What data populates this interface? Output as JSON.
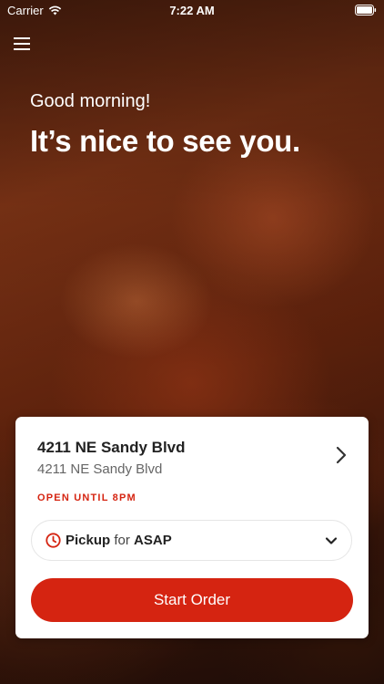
{
  "status_bar": {
    "carrier": "Carrier",
    "time": "7:22 AM",
    "wifi_icon": "wifi-icon",
    "battery_icon": "battery-icon"
  },
  "header": {
    "menu_icon": "hamburger-menu-icon",
    "greeting": "Good morning!",
    "headline": "It’s nice to see you."
  },
  "location_card": {
    "name": "4211 NE Sandy Blvd",
    "address": "4211 NE Sandy Blvd",
    "hours_status": "OPEN UNTIL 8PM",
    "chevron_icon": "chevron-right-icon"
  },
  "order_options": {
    "clock_icon": "clock-icon",
    "mode": "Pickup",
    "connector": "for",
    "time": "ASAP",
    "dropdown_icon": "chevron-down-icon"
  },
  "cta": {
    "label": "Start Order"
  },
  "colors": {
    "accent": "#d52411",
    "card_bg": "#ffffff",
    "text_dark": "#222222",
    "text_muted": "#666666"
  }
}
